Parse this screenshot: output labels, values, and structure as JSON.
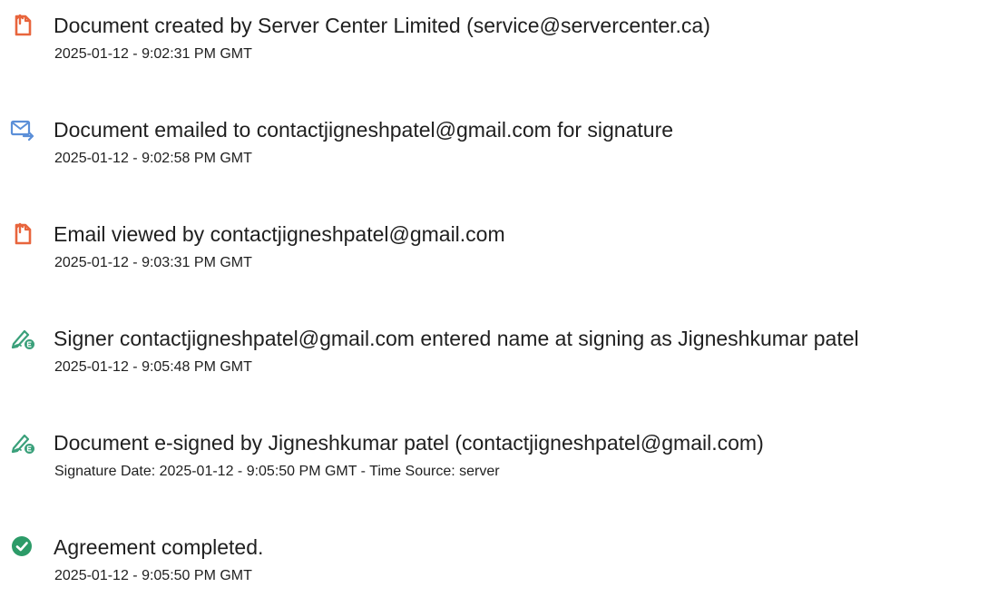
{
  "colors": {
    "doc_icon": "#e8653d",
    "email_icon": "#5b8fd8",
    "sign_icon": "#3aa07a",
    "check_icon": "#2c9b68",
    "text": "#1f1f1f"
  },
  "events": [
    {
      "icon": "document-icon",
      "title": "Document created by Server Center Limited (service@servercenter.ca)",
      "detail": "2025-01-12 - 9:02:31 PM GMT"
    },
    {
      "icon": "email-sent-icon",
      "title": "Document emailed to contactjigneshpatel@gmail.com for signature",
      "detail": "2025-01-12 - 9:02:58 PM GMT"
    },
    {
      "icon": "document-icon",
      "title": "Email viewed by contactjigneshpatel@gmail.com",
      "detail": "2025-01-12 - 9:03:31 PM GMT"
    },
    {
      "icon": "esign-pen-icon",
      "title": "Signer contactjigneshpatel@gmail.com entered name at signing as Jigneshkumar patel",
      "detail": "2025-01-12 - 9:05:48 PM GMT"
    },
    {
      "icon": "esign-pen-icon",
      "title": "Document e-signed by Jigneshkumar patel (contactjigneshpatel@gmail.com)",
      "detail": "Signature Date: 2025-01-12 - 9:05:50 PM GMT - Time Source: server"
    },
    {
      "icon": "check-circle-icon",
      "title": "Agreement completed.",
      "detail": "2025-01-12 - 9:05:50 PM GMT"
    }
  ]
}
